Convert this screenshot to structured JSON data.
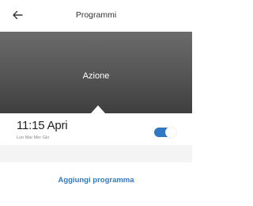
{
  "header": {
    "title": "Programmi",
    "back_icon": "arrow-left-icon"
  },
  "hero": {
    "label": "Azione"
  },
  "program": {
    "time_label": "11:15 Apri",
    "days": "Lun Mar Mer Gio",
    "enabled": true
  },
  "actions": {
    "add_label": "Aggiungi programma"
  },
  "colors": {
    "accent": "#2f78c4",
    "hero": "#545454"
  }
}
